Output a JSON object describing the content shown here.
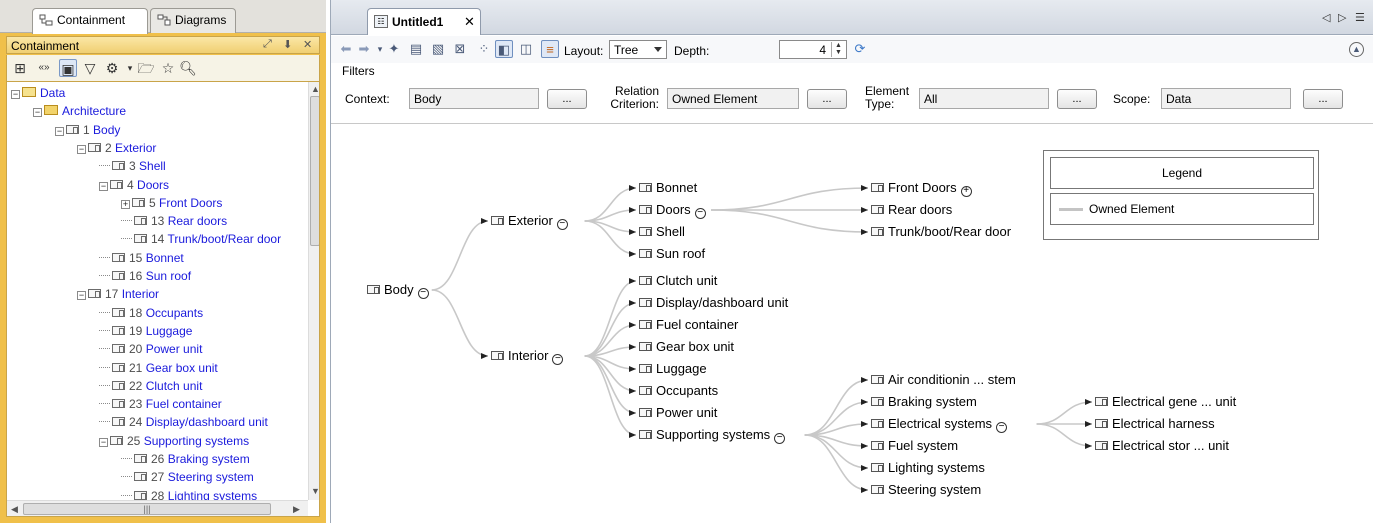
{
  "left_panel": {
    "tabs": [
      {
        "label": "Containment",
        "icon": "containment-icon",
        "active": true
      },
      {
        "label": "Diagrams",
        "icon": "diagrams-icon",
        "active": false
      }
    ],
    "header_title": "Containment",
    "tree": [
      {
        "num": "",
        "label": "Data",
        "indent": 0,
        "expander": "minus",
        "icon": "package-icon"
      },
      {
        "num": "",
        "label": "Architecture",
        "indent": 1,
        "expander": "minus",
        "icon": "folder-icon"
      },
      {
        "num": "1",
        "label": "Body",
        "indent": 2,
        "expander": "minus",
        "icon": "block-icon"
      },
      {
        "num": "2",
        "label": "Exterior",
        "indent": 3,
        "expander": "minus",
        "icon": "block-icon"
      },
      {
        "num": "3",
        "label": "Shell",
        "indent": 4,
        "expander": "",
        "icon": "block-icon"
      },
      {
        "num": "4",
        "label": "Doors",
        "indent": 4,
        "expander": "minus",
        "icon": "block-icon"
      },
      {
        "num": "5",
        "label": "Front Doors",
        "indent": 5,
        "expander": "plus",
        "icon": "block-icon"
      },
      {
        "num": "13",
        "label": "Rear doors",
        "indent": 5,
        "expander": "",
        "icon": "block-icon"
      },
      {
        "num": "14",
        "label": "Trunk/boot/Rear door",
        "indent": 5,
        "expander": "",
        "icon": "block-icon"
      },
      {
        "num": "15",
        "label": "Bonnet",
        "indent": 4,
        "expander": "",
        "icon": "block-icon"
      },
      {
        "num": "16",
        "label": "Sun roof",
        "indent": 4,
        "expander": "",
        "icon": "block-icon"
      },
      {
        "num": "17",
        "label": "Interior",
        "indent": 3,
        "expander": "minus",
        "icon": "block-icon"
      },
      {
        "num": "18",
        "label": "Occupants",
        "indent": 4,
        "expander": "",
        "icon": "block-icon"
      },
      {
        "num": "19",
        "label": "Luggage",
        "indent": 4,
        "expander": "",
        "icon": "block-icon"
      },
      {
        "num": "20",
        "label": "Power unit",
        "indent": 4,
        "expander": "",
        "icon": "block-icon"
      },
      {
        "num": "21",
        "label": "Gear box unit",
        "indent": 4,
        "expander": "",
        "icon": "block-icon"
      },
      {
        "num": "22",
        "label": "Clutch unit",
        "indent": 4,
        "expander": "",
        "icon": "block-icon"
      },
      {
        "num": "23",
        "label": "Fuel container",
        "indent": 4,
        "expander": "",
        "icon": "block-icon"
      },
      {
        "num": "24",
        "label": "Display/dashboard unit",
        "indent": 4,
        "expander": "",
        "icon": "block-icon"
      },
      {
        "num": "25",
        "label": "Supporting systems",
        "indent": 4,
        "expander": "minus",
        "icon": "block-icon"
      },
      {
        "num": "26",
        "label": "Braking system",
        "indent": 5,
        "expander": "",
        "icon": "block-icon"
      },
      {
        "num": "27",
        "label": "Steering system",
        "indent": 5,
        "expander": "",
        "icon": "block-icon"
      },
      {
        "num": "28",
        "label": "Lighting systems",
        "indent": 5,
        "expander": "",
        "icon": "block-icon"
      }
    ]
  },
  "editor": {
    "tab_label": "Untitled1",
    "toolbar": {
      "layout_label": "Layout:",
      "layout_value": "Tree",
      "depth_label": "Depth:",
      "depth_value": "4"
    },
    "filters": {
      "title": "Filters",
      "context_label": "Context:",
      "context_value": "Body",
      "relation_label_1": "Relation",
      "relation_label_2": "Criterion:",
      "relation_value": "Owned Element",
      "type_label_1": "Element",
      "type_label_2": "Type:",
      "type_value": "All",
      "scope_label": "Scope:",
      "scope_value": "Data",
      "browse_label": "..."
    },
    "legend": {
      "title": "Legend",
      "item": "Owned Element",
      "line_color": "#c4c4c4"
    }
  },
  "diagram": {
    "root": {
      "label": "Body",
      "toggle": "collapse"
    },
    "level1": [
      {
        "label": "Exterior",
        "toggle": "collapse"
      },
      {
        "label": "Interior",
        "toggle": "collapse"
      }
    ],
    "exterior_children": [
      {
        "label": "Bonnet",
        "toggle": ""
      },
      {
        "label": "Doors",
        "toggle": "collapse"
      },
      {
        "label": "Shell",
        "toggle": ""
      },
      {
        "label": "Sun roof",
        "toggle": ""
      }
    ],
    "doors_children": [
      {
        "label": "Front Doors",
        "toggle": "expand"
      },
      {
        "label": "Rear doors",
        "toggle": ""
      },
      {
        "label": "Trunk/boot/Rear door",
        "toggle": ""
      }
    ],
    "interior_children": [
      {
        "label": "Clutch unit",
        "toggle": ""
      },
      {
        "label": "Display/dashboard unit",
        "toggle": ""
      },
      {
        "label": "Fuel container",
        "toggle": ""
      },
      {
        "label": "Gear box unit",
        "toggle": ""
      },
      {
        "label": "Luggage",
        "toggle": ""
      },
      {
        "label": "Occupants",
        "toggle": ""
      },
      {
        "label": "Power unit",
        "toggle": ""
      },
      {
        "label": "Supporting systems",
        "toggle": "collapse"
      }
    ],
    "supporting_children": [
      {
        "label": "Air conditionin ... stem",
        "toggle": ""
      },
      {
        "label": "Braking system",
        "toggle": ""
      },
      {
        "label": "Electrical systems",
        "toggle": "collapse"
      },
      {
        "label": "Fuel system",
        "toggle": ""
      },
      {
        "label": "Lighting systems",
        "toggle": ""
      },
      {
        "label": "Steering system",
        "toggle": ""
      }
    ],
    "electrical_children": [
      {
        "label": "Electrical gene ... unit",
        "toggle": ""
      },
      {
        "label": "Electrical harness",
        "toggle": ""
      },
      {
        "label": "Electrical stor ... unit",
        "toggle": ""
      }
    ]
  }
}
